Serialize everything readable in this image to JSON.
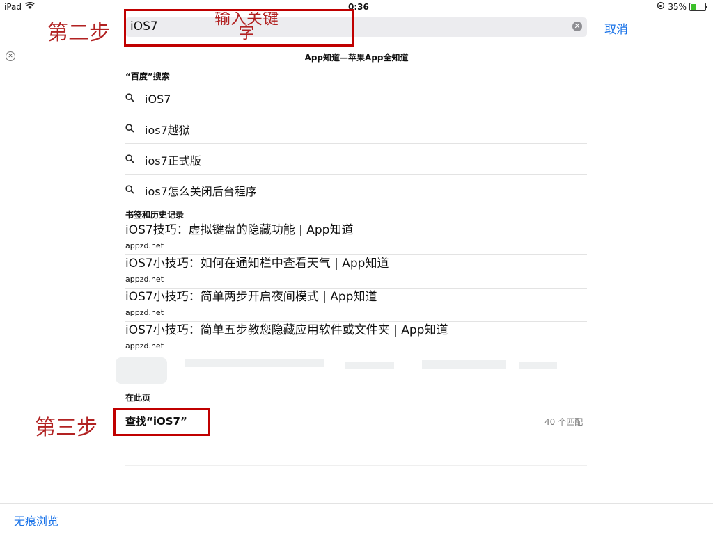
{
  "status": {
    "device": "iPad",
    "time": "0:36",
    "battery": "35%"
  },
  "search": {
    "query": "iOS7",
    "cancel_label": "取消"
  },
  "annotations": {
    "step2": "第二步",
    "step2_hint": "输入关键字",
    "step3": "第三步"
  },
  "page": {
    "title": "App知道—苹果App全知道"
  },
  "baidu": {
    "header": "“百度”搜索",
    "suggestions": [
      "iOS7",
      "ios7越狱",
      "ios7正式版",
      "ios7怎么关闭后台程序"
    ]
  },
  "bookmarks": {
    "header": "书签和历史记录",
    "items": [
      {
        "title": "iOS7技巧：虚拟键盘的隐藏功能 | App知道",
        "url": "appzd.net"
      },
      {
        "title": "iOS7小技巧：如何在通知栏中查看天气 | App知道",
        "url": "appzd.net"
      },
      {
        "title": "iOS7小技巧：简单两步开启夜间模式 | App知道",
        "url": "appzd.net"
      },
      {
        "title": "iOS7小技巧：简单五步教您隐藏应用软件或文件夹 | App知道",
        "url": "appzd.net"
      }
    ]
  },
  "onpage": {
    "header": "在此页",
    "find_label": "查找“iOS7”",
    "match_count": "40 个匹配"
  },
  "footer": {
    "private_label": "无痕浏览"
  },
  "colors": {
    "accent": "#1a73e8",
    "annotation": "#c00000",
    "battery": "#3cc02a"
  }
}
